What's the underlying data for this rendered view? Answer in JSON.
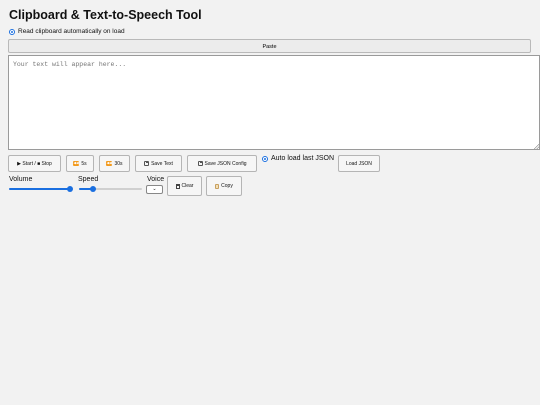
{
  "title": "Clipboard & Text-to-Speech Tool",
  "auto_read_label": "Read clipboard automatically on load",
  "paste_label": "Paste",
  "textarea_placeholder": "Your text will appear here...",
  "buttons": {
    "start_stop": "▶ Start / ■ Stop",
    "back5": "5s",
    "back30": "30s",
    "save_text": "Save Text",
    "save_json": "Save JSON Config",
    "auto_load": "Auto load last JSON",
    "load_json": "Load JSON",
    "clear": "Clear",
    "copy": "Copy"
  },
  "controls": {
    "volume_label": "Volume",
    "speed_label": "Speed",
    "voice_label": "Voice",
    "volume_value": 1.0,
    "speed_value": 0.22,
    "voice_selected": ""
  },
  "colors": {
    "accent": "#1a6fe0",
    "rewind_icon": "#f29a1d"
  }
}
